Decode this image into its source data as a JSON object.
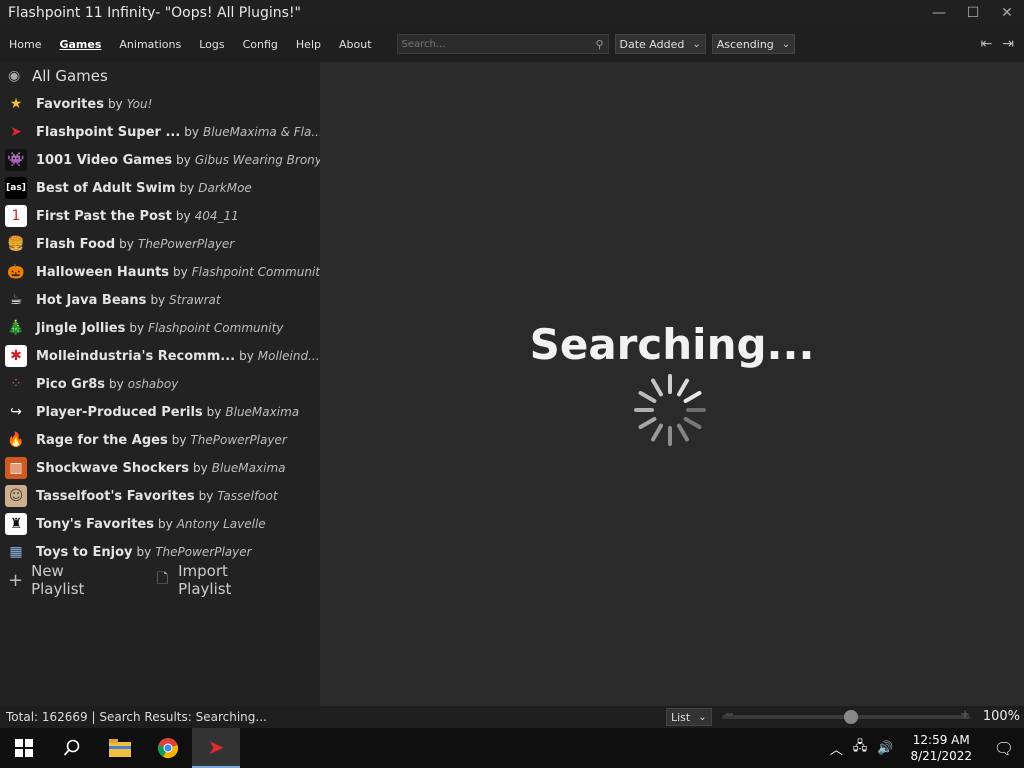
{
  "window": {
    "title": "Flashpoint 11 Infinity- \"Oops! All Plugins!\"",
    "controls": [
      "—",
      "☐",
      "✕"
    ]
  },
  "menu": {
    "items": [
      {
        "label": "Home",
        "active": false
      },
      {
        "label": "Games",
        "active": true
      },
      {
        "label": "Animations",
        "active": false
      },
      {
        "label": "Logs",
        "active": false
      },
      {
        "label": "Config",
        "active": false
      },
      {
        "label": "Help",
        "active": false
      },
      {
        "label": "About",
        "active": false
      }
    ],
    "search_placeholder": "Search...",
    "order_by": "Date Added",
    "order_direction": "Ascending"
  },
  "sidebar": {
    "all_games": "All Games",
    "by_word": "by",
    "playlists": [
      {
        "name": "Favorites",
        "author": "You!",
        "icon": "star-icon",
        "glyph": "★",
        "color": "#f3c12d",
        "bg": "transparent"
      },
      {
        "name": "Flashpoint Super ...",
        "author": "BlueMaxima & Fla...",
        "icon": "flashpoint-logo-icon",
        "glyph": "➤",
        "color": "#e0282e",
        "bg": "transparent"
      },
      {
        "name": "1001 Video Games",
        "author": "Gibus Wearing Brony",
        "icon": "space-invader-icon",
        "glyph": "👾",
        "color": "#ffffff",
        "bg": "#111111"
      },
      {
        "name": "Best of Adult Swim",
        "author": "DarkMoe",
        "icon": "adult-swim-icon",
        "glyph": "[as]",
        "color": "#ffffff",
        "bg": "#000000"
      },
      {
        "name": "First Past the Post",
        "author": "404_11",
        "icon": "number-one-icon",
        "glyph": "1",
        "color": "#d42020",
        "bg": "#ffffff"
      },
      {
        "name": "Flash Food",
        "author": "ThePowerPlayer",
        "icon": "burger-icon",
        "glyph": "🍔",
        "color": "#e0a040",
        "bg": "transparent"
      },
      {
        "name": "Halloween Haunts",
        "author": "Flashpoint Community",
        "icon": "pumpkin-icon",
        "glyph": "🎃",
        "color": "#f08020",
        "bg": "transparent"
      },
      {
        "name": "Hot Java Beans",
        "author": "Strawrat",
        "icon": "coffee-cup-icon",
        "glyph": "☕",
        "color": "#ffffff",
        "bg": "transparent"
      },
      {
        "name": "Jingle Jollies",
        "author": "Flashpoint Community",
        "icon": "christmas-tree-icon",
        "glyph": "🎄",
        "color": "#30a040",
        "bg": "transparent"
      },
      {
        "name": "Molleindustria's Recomm...",
        "author": "Molleind...",
        "icon": "molleindustria-icon",
        "glyph": "✱",
        "color": "#d02020",
        "bg": "#ffffff"
      },
      {
        "name": "Pico Gr8s",
        "author": "oshaboy",
        "icon": "pico-pixels-icon",
        "glyph": "⁘",
        "color": "#e040a0",
        "bg": "transparent"
      },
      {
        "name": "Player-Produced Perils",
        "author": "BlueMaxima",
        "icon": "share-arrow-icon",
        "glyph": "↪",
        "color": "#ffffff",
        "bg": "transparent"
      },
      {
        "name": "Rage for the Ages",
        "author": "ThePowerPlayer",
        "icon": "flame-icon",
        "glyph": "🔥",
        "color": "#f07020",
        "bg": "transparent"
      },
      {
        "name": "Shockwave Shockers",
        "author": "BlueMaxima",
        "icon": "shockwave-icon",
        "glyph": "▥",
        "color": "#ffffff",
        "bg": "#d05a20"
      },
      {
        "name": "Tasselfoot's Favorites",
        "author": "Tasselfoot",
        "icon": "tasselfoot-avatar-icon",
        "glyph": "☺",
        "color": "#5a4030",
        "bg": "#c8b090"
      },
      {
        "name": "Tony's Favorites",
        "author": "Antony Lavelle",
        "icon": "silhouette-icon",
        "glyph": "♜",
        "color": "#111111",
        "bg": "#ffffff"
      },
      {
        "name": "Toys to Enjoy",
        "author": "ThePowerPlayer",
        "icon": "toy-blocks-icon",
        "glyph": "▦",
        "color": "#8ab0e0",
        "bg": "transparent"
      }
    ],
    "new_playlist": "New Playlist",
    "import_playlist": "Import Playlist"
  },
  "main": {
    "status": "Searching..."
  },
  "statusbar": {
    "text": "Total: 162669 | Search Results: Searching...",
    "view_mode": "List",
    "zoom_level": 0.52,
    "zoom": "100%"
  },
  "taskbar": {
    "time": "12:59 AM",
    "date": "8/21/2022",
    "active_app": "flashpoint"
  }
}
